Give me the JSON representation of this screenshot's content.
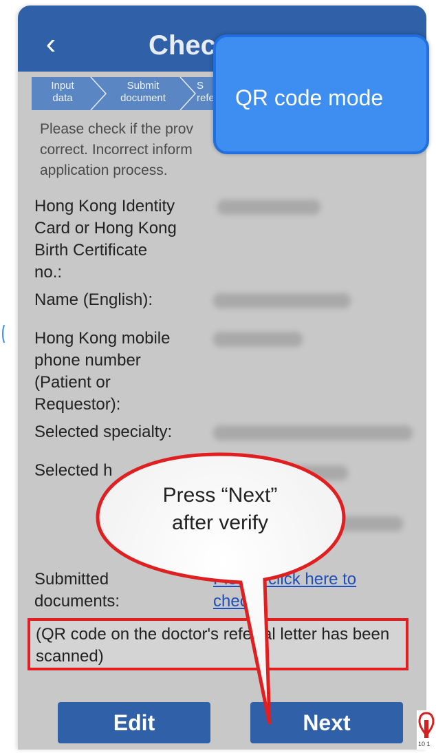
{
  "nav": {
    "back_icon": "‹",
    "title": "Chec"
  },
  "steps": [
    "Input\ndata",
    "Submit\ndocument",
    "S\nrefe"
  ],
  "intro": "Please check if the prov\ncorrect. Incorrect inform\napplication process.",
  "fields": {
    "hkid_label": "Hong Kong Identity\nCard or Hong Kong\nBirth Certificate\nno.:",
    "name_label": "Name (English):",
    "phone_label": "Hong Kong mobile\nphone number\n(Patient or\nRequestor):",
    "specialty_label": "Selected specialty:",
    "hospital_label": "Selected h",
    "documents_label": "Submitted\ndocuments:",
    "documents_link": "Please click here to\ncheck"
  },
  "note": "(QR code on the doctor's referral letter has been scanned)",
  "buttons": {
    "edit": "Edit",
    "next": "Next"
  },
  "callouts": {
    "qr_mode": "QR code mode",
    "press_next": "Press “Next”\nafter verify"
  },
  "logo_caption": "10 1",
  "colors": {
    "nav_blue": "#2f60a8",
    "callout_blue": "#3d8ef0",
    "highlight_red": "#e02020"
  }
}
